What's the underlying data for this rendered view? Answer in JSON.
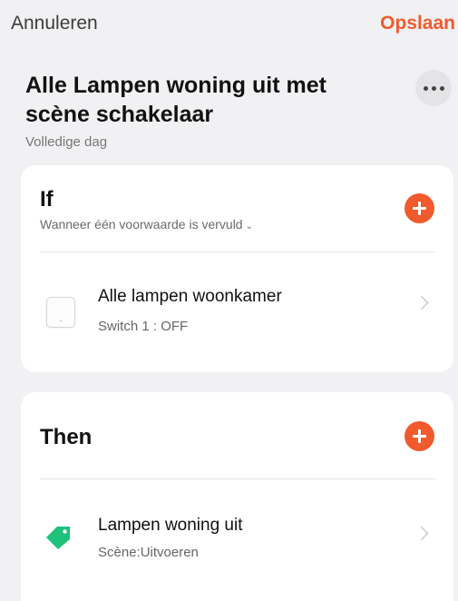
{
  "header": {
    "cancel_label": "Annuleren",
    "save_label": "Opslaan"
  },
  "scene": {
    "title": "Alle Lampen woning uit met scène schakelaar",
    "schedule": "Volledige dag"
  },
  "if_section": {
    "label": "If",
    "condition_mode": "Wanneer één voorwaarde is vervuld",
    "items": [
      {
        "title": "Alle lampen woonkamer",
        "subtitle": "Switch 1 : OFF"
      }
    ]
  },
  "then_section": {
    "label": "Then",
    "items": [
      {
        "title": "Lampen woning uit",
        "subtitle": "Scène:Uitvoeren"
      }
    ]
  },
  "colors": {
    "accent": "#f15a2c",
    "scene_tag": "#1fc27a",
    "background": "#f1f1f3"
  },
  "icons": {
    "more": "more-horizontal-icon",
    "add": "plus-circle-icon",
    "device": "switch-device-icon",
    "scene": "scene-tag-icon",
    "chevron": "chevron-right-icon"
  }
}
